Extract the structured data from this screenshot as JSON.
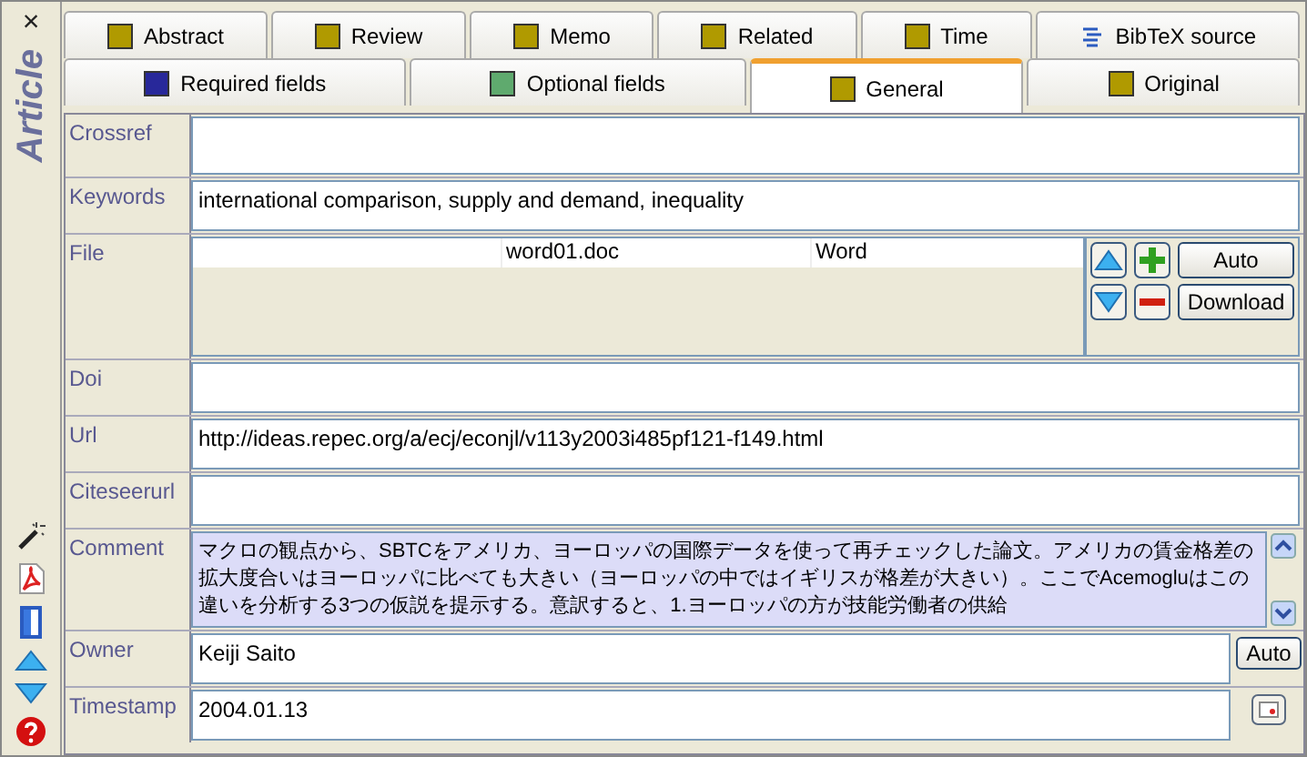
{
  "close_symbol": "×",
  "entry_type": "Article",
  "tab_rows": [
    {
      "tabs": [
        {
          "label": "Abstract",
          "kind": "square",
          "color": "#b09a00",
          "selected": false
        },
        {
          "label": "Review",
          "kind": "square",
          "color": "#b09a00",
          "selected": false
        },
        {
          "label": "Memo",
          "kind": "square",
          "color": "#b09a00",
          "selected": false
        },
        {
          "label": "Related",
          "kind": "square",
          "color": "#b09a00",
          "selected": false
        },
        {
          "label": "Time",
          "kind": "square",
          "color": "#b09a00",
          "selected": false
        },
        {
          "label": "BibTeX source",
          "kind": "source",
          "selected": false
        }
      ]
    },
    {
      "tabs": [
        {
          "label": "Required fields",
          "kind": "square",
          "color": "#28289a",
          "selected": false
        },
        {
          "label": "Optional fields",
          "kind": "square",
          "color": "#5faa6e",
          "selected": false
        },
        {
          "label": "General",
          "kind": "square",
          "color": "#b09a00",
          "selected": true
        },
        {
          "label": "Original",
          "kind": "square",
          "color": "#b09a00",
          "selected": false
        }
      ]
    }
  ],
  "fields": [
    {
      "label": "Crossref",
      "kind": "text"
    },
    {
      "label": "Keywords",
      "kind": "text",
      "value": "international comparison, supply and demand, inequality"
    },
    {
      "label": "File",
      "kind": "file",
      "files": [
        {
          "column_2": "word01.doc",
          "column_3": "Word"
        }
      ],
      "buttons": [
        "Auto",
        "Download"
      ]
    },
    {
      "label": "Doi",
      "kind": "text"
    },
    {
      "label": "Url",
      "kind": "text",
      "value": "http://ideas.repec.org/a/ecj/econjl/v113y2003i485pf121-f149.html"
    },
    {
      "label": "Citeseerurl",
      "kind": "text"
    },
    {
      "label": "Comment",
      "kind": "comment",
      "focused": true,
      "value": "マクロの観点から、SBTCをアメリカ、ヨーロッパの国際データを使って再チェックした論文。アメリカの賃金格差の拡大度合いはヨーロッパに比べても大きい（ヨーロッパの中ではイギリスが格差が大きい）。ここでAcemogluはこの違いを分析する3つの仮説を提示する。意訳すると、1.ヨーロッパの方が技能労働者の供給"
    },
    {
      "label": "Owner",
      "kind": "text",
      "value": "Keiji Saito",
      "button": "Auto"
    },
    {
      "label": "Timestamp",
      "kind": "text",
      "value": "2004.01.13",
      "picker": true
    }
  ]
}
